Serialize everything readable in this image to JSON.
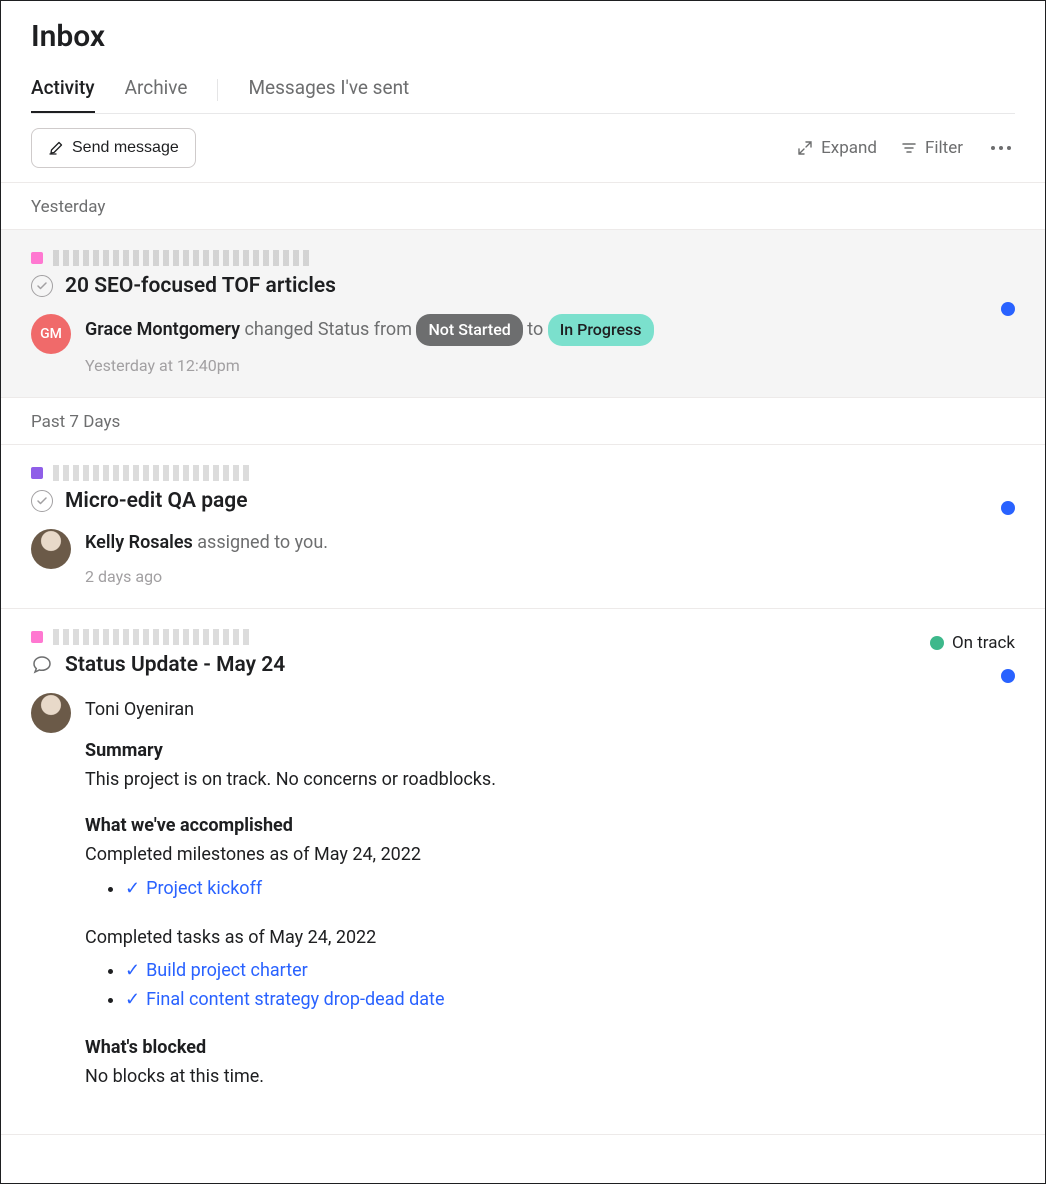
{
  "header": {
    "title": "Inbox",
    "tabs": [
      "Activity",
      "Archive",
      "Messages I've sent"
    ]
  },
  "toolbar": {
    "send_label": "Send message",
    "expand_label": "Expand",
    "filter_label": "Filter"
  },
  "sections": {
    "yesterday": "Yesterday",
    "past7": "Past 7 Days"
  },
  "notifs": [
    {
      "task_title": "20 SEO-focused TOF articles",
      "actor": "Grace Montgomery",
      "actor_initials": "GM",
      "action_prefix": " changed Status from ",
      "status_from": "Not Started",
      "action_mid": " to ",
      "status_to": "In Progress",
      "timestamp": "Yesterday at 12:40pm"
    },
    {
      "task_title": "Micro-edit QA page",
      "actor": "Kelly Rosales",
      "action": " assigned to you.",
      "timestamp": "2 days ago"
    },
    {
      "task_title": "Status Update - May 24",
      "status_badge": "On track",
      "author": "Toni Oyeniran",
      "summary_h": "Summary",
      "summary_p": "This project is on track. No concerns or roadblocks.",
      "accomplished_h": "What we've accomplished",
      "milestones_label": "Completed milestones as of May 24, 2022",
      "milestones": [
        "Project kickoff"
      ],
      "tasks_label": "Completed tasks as of May 24, 2022",
      "tasks": [
        "Build project charter",
        "Final content strategy drop-dead date"
      ],
      "blocked_h": "What's blocked",
      "blocked_p": "No blocks at this time."
    }
  ]
}
